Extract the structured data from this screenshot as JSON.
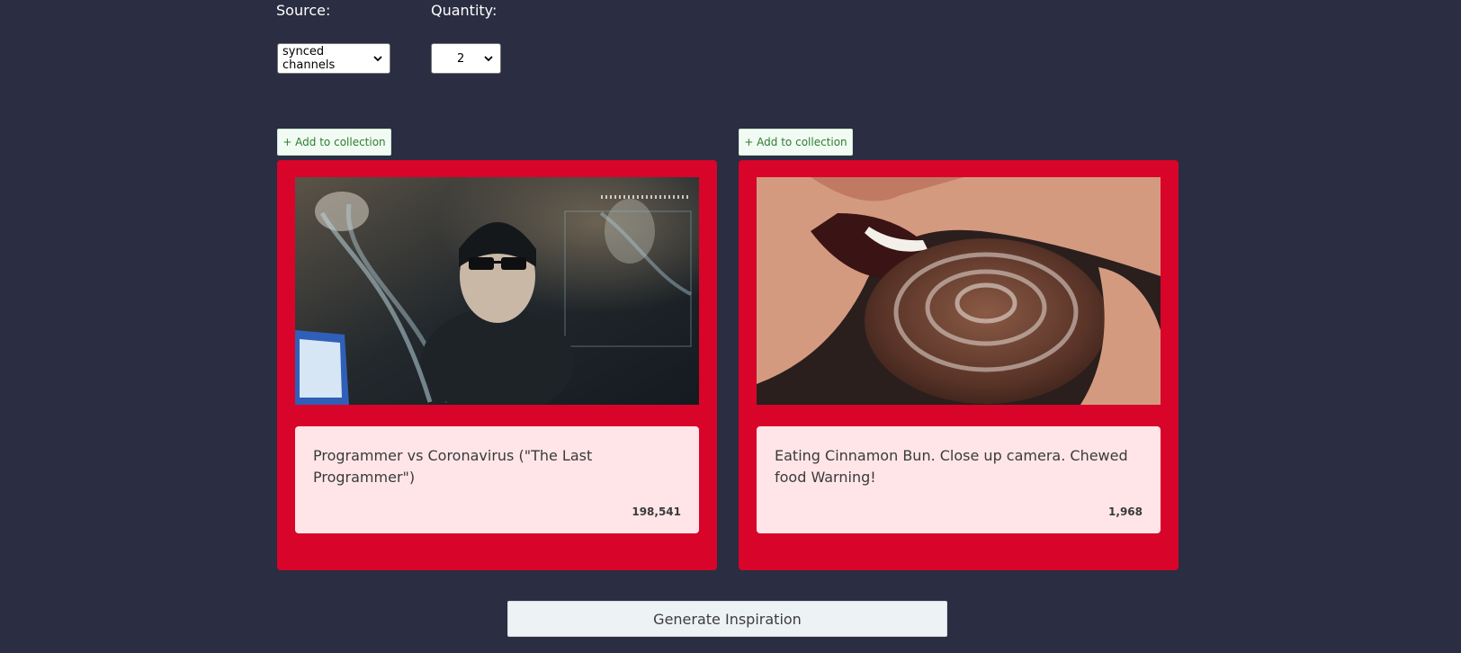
{
  "controls": {
    "source_label": "Source:",
    "source_value": "synced channels",
    "quantity_label": "Quantity:",
    "quantity_value": "2"
  },
  "cards": [
    {
      "add_label": "+ Add to collection",
      "title": "Programmer vs Coronavirus (\"The Last Programmer\")",
      "views": "198,541"
    },
    {
      "add_label": "+ Add to collection",
      "title": "Eating Cinnamon Bun. Close up camera. Chewed food Warning!",
      "views": "1,968"
    }
  ],
  "actions": {
    "generate_label": "Generate Inspiration"
  },
  "colors": {
    "background": "#2b2d42",
    "card": "#d90429",
    "info_panel": "#ffe5e8",
    "add_button_text": "#2e7d32"
  },
  "icons": {
    "select_arrow": "chevron-down-icon"
  }
}
